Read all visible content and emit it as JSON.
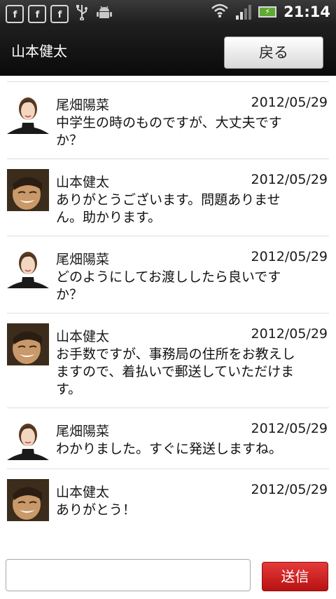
{
  "status_bar": {
    "notification_icons": [
      "facebook-icon",
      "facebook-icon",
      "facebook-icon",
      "usb-icon",
      "android-debug-icon"
    ],
    "fb_label": "f",
    "time": "21:14"
  },
  "header": {
    "title": "山本健太",
    "back_label": "戻る"
  },
  "messages": [
    {
      "sender": "尾畑陽菜",
      "date": "2012/05/29",
      "line1": "中学生の時のものですが、大丈夫です",
      "line2": "か？",
      "line3": "",
      "avatar": "female"
    },
    {
      "sender": "山本健太",
      "date": "2012/05/29",
      "line1": "ありがとうございます。問題ありませ",
      "line2": "ん。助かります。",
      "line3": "",
      "avatar": "male"
    },
    {
      "sender": "尾畑陽菜",
      "date": "2012/05/29",
      "line1": "どのようにしてお渡ししたら良いです",
      "line2": "か？",
      "line3": "",
      "avatar": "female"
    },
    {
      "sender": "山本健太",
      "date": "2012/05/29",
      "line1": "お手数ですが、事務局の住所をお教えし",
      "line2": "ますので、着払いで郵送していただけま",
      "line3": "す。",
      "avatar": "male"
    },
    {
      "sender": "尾畑陽菜",
      "date": "2012/05/29",
      "line1": "わかりました。すぐに発送しますね。",
      "line2": "",
      "line3": "",
      "avatar": "female"
    },
    {
      "sender": "山本健太",
      "date": "2012/05/29",
      "line1": "ありがとう！",
      "line2": "",
      "line3": "",
      "avatar": "male"
    }
  ],
  "compose": {
    "input_value": "",
    "placeholder": "",
    "send_label": "送信"
  },
  "colors": {
    "send_button": "#d32020",
    "header_bg": "#111111"
  }
}
